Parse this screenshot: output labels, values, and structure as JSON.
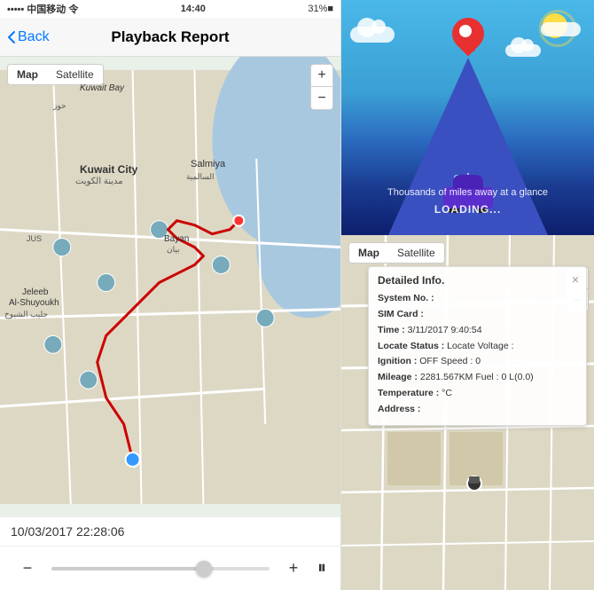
{
  "statusBar": {
    "left": "••••• 中国移动 令",
    "center": "14:40",
    "right": "31%■"
  },
  "navBar": {
    "backLabel": "Back",
    "title": "Playback Report"
  },
  "mapTypeOptions": [
    "Map",
    "Satellite"
  ],
  "mapTypeActive": "Map",
  "zoomIn": "+",
  "zoomOut": "−",
  "playbackTime": "10/03/2017 22:28:06",
  "playbackControls": {
    "minus": "−",
    "plus": "+",
    "pause": "⏸"
  },
  "illustration": {
    "tagline": "Thousands of miles away at a glance",
    "loading": "LOADING..."
  },
  "detailInfo": {
    "title": "Detailed Info.",
    "fields": [
      {
        "label": "System No. :",
        "value": ""
      },
      {
        "label": "SIM Card :",
        "value": ""
      },
      {
        "label": "Time :",
        "value": "3/11/2017 9:40:54"
      },
      {
        "label": "Locate Status :",
        "value": "Locate Voltage :"
      },
      {
        "label": "Ignition :",
        "value": "OFF Speed : 0"
      },
      {
        "label": "Mileage :",
        "value": "2281.567KM Fuel : 0 L(0.0)"
      },
      {
        "label": "Temperature :",
        "value": "°C"
      },
      {
        "label": "Address :",
        "value": ""
      }
    ]
  }
}
